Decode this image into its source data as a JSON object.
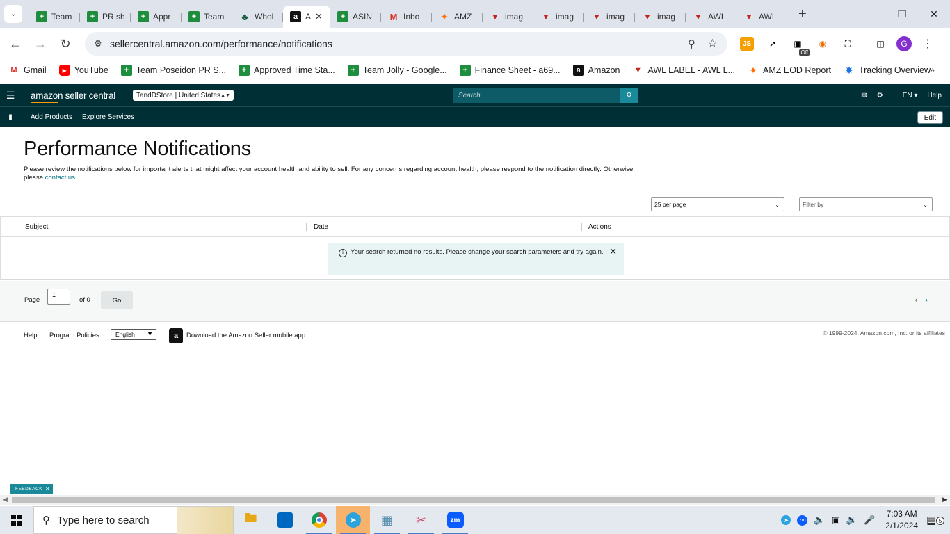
{
  "browser": {
    "tabs": [
      {
        "label": "Team",
        "icon": "sheets-icon",
        "active": false
      },
      {
        "label": "PR sh",
        "icon": "sheets-icon",
        "active": false
      },
      {
        "label": "Appr",
        "icon": "sheets-icon",
        "active": false
      },
      {
        "label": "Team",
        "icon": "sheets-icon",
        "active": false
      },
      {
        "label": "Whol",
        "icon": "clover-icon",
        "active": false
      },
      {
        "label": "A",
        "icon": "amazon-icon",
        "active": true
      },
      {
        "label": "ASIN",
        "icon": "sheets-icon",
        "active": false
      },
      {
        "label": "Inbo",
        "icon": "gmail-icon",
        "active": false
      },
      {
        "label": "AMZ",
        "icon": "amz-icon",
        "active": false
      },
      {
        "label": "imag",
        "icon": "awl-icon",
        "active": false
      },
      {
        "label": "imag",
        "icon": "awl-icon",
        "active": false
      },
      {
        "label": "imag",
        "icon": "awl-icon",
        "active": false
      },
      {
        "label": "imag",
        "icon": "awl-icon",
        "active": false
      },
      {
        "label": "AWL",
        "icon": "awl-icon",
        "active": false
      },
      {
        "label": "AWL",
        "icon": "awl-icon",
        "active": false
      }
    ],
    "url": "sellercentral.amazon.com/performance/notifications",
    "extensions": {
      "js_label": "JS",
      "off_badge": "Off",
      "profile_initial": "G"
    },
    "bookmarks": [
      {
        "label": "Gmail",
        "icon": "gmail-icon"
      },
      {
        "label": "YouTube",
        "icon": "youtube-icon"
      },
      {
        "label": "Team Poseidon PR S...",
        "icon": "sheets-icon"
      },
      {
        "label": "Approved Time Sta...",
        "icon": "sheets-icon"
      },
      {
        "label": "Team Jolly - Google...",
        "icon": "sheets-icon"
      },
      {
        "label": "Finance Sheet - a69...",
        "icon": "sheets-icon"
      },
      {
        "label": "Amazon",
        "icon": "amazon-icon"
      },
      {
        "label": "AWL LABEL - AWL L...",
        "icon": "awl-icon"
      },
      {
        "label": "AMZ EOD Report",
        "icon": "amz-icon"
      },
      {
        "label": "Tracking Overview",
        "icon": "tracking-icon"
      }
    ]
  },
  "seller_central": {
    "logo": "amazon seller central",
    "store": "TandDStore | United States",
    "search_placeholder": "Search",
    "language": "EN",
    "help": "Help",
    "subnav": [
      "Add Products",
      "Explore Services"
    ],
    "edit_label": "Edit"
  },
  "page": {
    "title": "Performance Notifications",
    "intro_text": "Please review the notifications below for important alerts that might affect your account health and ability to sell. For any concerns regarding account health, please respond to the notification directly. Otherwise, please",
    "contact_link": "contact us",
    "intro_end": ".",
    "per_page": "25 per page",
    "filter_by": "Filter by",
    "columns": [
      "Subject",
      "Date",
      "Actions"
    ],
    "no_results": "Your search returned no results. Please change your search parameters and try again.",
    "pager": {
      "page_label": "Page",
      "page_value": "1",
      "of_label": "of 0",
      "go_label": "Go"
    }
  },
  "footer": {
    "help": "Help",
    "program_policies": "Program Policies",
    "language": "English",
    "app_text": "Download the Amazon Seller mobile app",
    "copyright": "© 1999-2024, Amazon.com, Inc. or its affiliates"
  },
  "feedback_label": "FEEDBACK",
  "taskbar": {
    "search_placeholder": "Type here to search",
    "time": "7:03 AM",
    "date": "2/1/2024",
    "notification_count": "5"
  }
}
